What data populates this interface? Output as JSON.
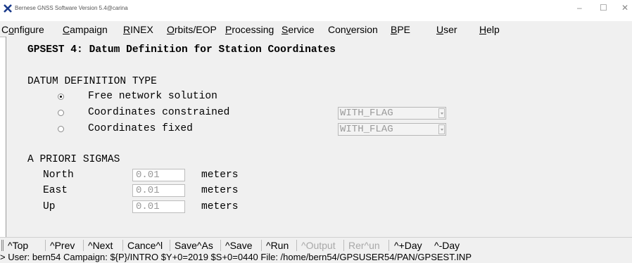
{
  "window": {
    "title": "Bernese GNSS Software Version 5.4@carina",
    "controls": [
      "–",
      "☐",
      "✕"
    ]
  },
  "menu": {
    "configure": "Configure",
    "campaign": "Campaign",
    "rinex": "RINEX",
    "orbits": "Orbits/EOP",
    "processing": "Processing",
    "service": "Service",
    "conversion": "Conversion",
    "bpe": "BPE",
    "user": "User",
    "help": "Help"
  },
  "panel": {
    "title": "GPSEST 4: Datum Definition for Station Coordinates",
    "datum_heading": "DATUM DEFINITION TYPE",
    "options": [
      {
        "label": "Free network solution",
        "selected": true
      },
      {
        "label": "Coordinates constrained",
        "selected": false,
        "select_value": "WITH_FLAG"
      },
      {
        "label": "Coordinates fixed",
        "selected": false,
        "select_value": "WITH_FLAG"
      }
    ],
    "sigma_heading": "A PRIORI SIGMAS",
    "sigmas": [
      {
        "label": "North",
        "value": "0.01",
        "unit": "meters"
      },
      {
        "label": "East",
        "value": "0.01",
        "unit": "meters"
      },
      {
        "label": "Up",
        "value": "0.01",
        "unit": "meters"
      }
    ]
  },
  "toolbar": {
    "top": "^Top",
    "prev": "^Prev",
    "next": "^Next",
    "cancel": "Cance^l",
    "saveas": "Save^As",
    "save": "^Save",
    "run": "^Run",
    "output": "^Output",
    "rerun": "Rer^un",
    "plusday": "^+Day",
    "minusday": "^-Day"
  },
  "status": {
    "text": "> User: bern54  Campaign: ${P}/INTRO  $Y+0=2019  $S+0=0440  File: /home/bern54/GPSUSER54/PAN/GPSEST.INP"
  }
}
